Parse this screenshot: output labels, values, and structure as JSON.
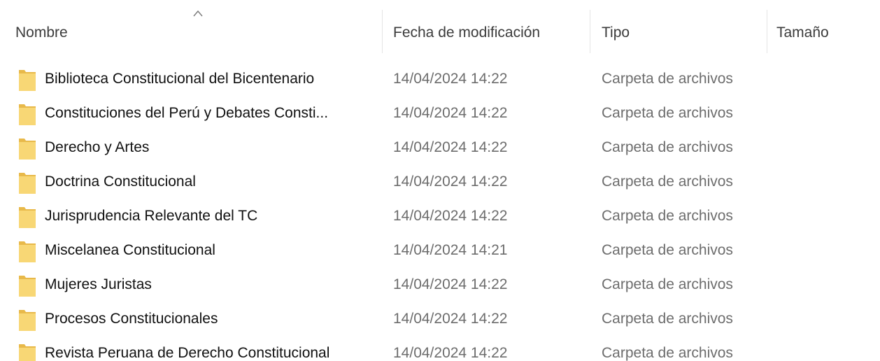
{
  "header": {
    "columns": {
      "name": "Nombre",
      "date": "Fecha de modificación",
      "type": "Tipo",
      "size": "Tamaño"
    },
    "sort_icon": "chevron-up-icon"
  },
  "rows": [
    {
      "name": "Biblioteca Constitucional del Bicentenario",
      "date": "14/04/2024 14:22",
      "type": "Carpeta de archivos",
      "icon": "folder-icon"
    },
    {
      "name": "Constituciones del Perú y Debates Consti...",
      "date": "14/04/2024 14:22",
      "type": "Carpeta de archivos",
      "icon": "folder-icon"
    },
    {
      "name": "Derecho y Artes",
      "date": "14/04/2024 14:22",
      "type": "Carpeta de archivos",
      "icon": "folder-icon"
    },
    {
      "name": "Doctrina Constitucional",
      "date": "14/04/2024 14:22",
      "type": "Carpeta de archivos",
      "icon": "folder-icon"
    },
    {
      "name": "Jurisprudencia Relevante del TC",
      "date": "14/04/2024 14:22",
      "type": "Carpeta de archivos",
      "icon": "folder-icon"
    },
    {
      "name": "Miscelanea Constitucional",
      "date": "14/04/2024 14:21",
      "type": "Carpeta de archivos",
      "icon": "folder-icon"
    },
    {
      "name": "Mujeres Juristas",
      "date": "14/04/2024 14:22",
      "type": "Carpeta de archivos",
      "icon": "folder-icon"
    },
    {
      "name": "Procesos Constitucionales",
      "date": "14/04/2024 14:22",
      "type": "Carpeta de archivos",
      "icon": "folder-icon"
    },
    {
      "name": "Revista Peruana de Derecho Constitucional",
      "date": "14/04/2024 14:22",
      "type": "Carpeta de archivos",
      "icon": "folder-icon"
    }
  ],
  "colors": {
    "folder_fill": "#f8d775",
    "folder_dark": "#e8b94a",
    "header_text": "#3b3b3b",
    "secondary_text": "#6d6d6d"
  }
}
